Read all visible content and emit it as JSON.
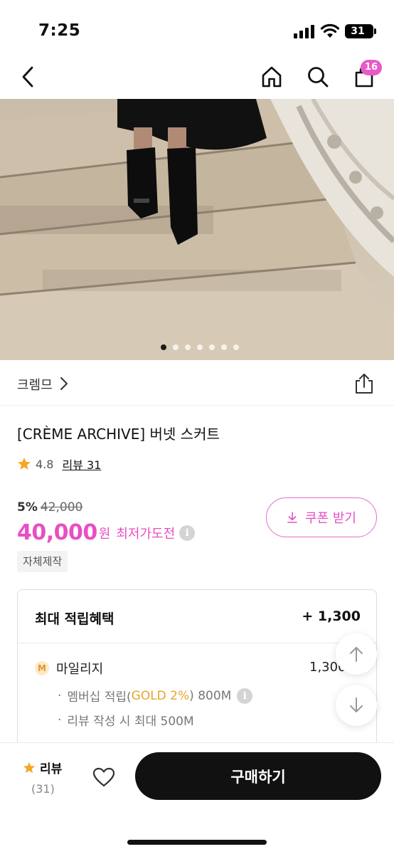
{
  "status_bar": {
    "time": "7:25",
    "battery": "31"
  },
  "nav": {
    "cart_count": "16",
    "back_icon": "back-arrow-icon",
    "home_icon": "home-icon",
    "search_icon": "search-icon",
    "cart_icon": "shopping-bag-icon"
  },
  "hero": {
    "slides": 7,
    "active_slide": 1
  },
  "brand": {
    "name": "크렘므"
  },
  "product": {
    "title": "[CRÈME ARCHIVE] 버넷 스커트",
    "rating": "4.8",
    "review_link": "리뷰 31"
  },
  "price": {
    "discount_rate": "5%",
    "original_price": "42,000",
    "sale_price": "40,000",
    "unit": "원",
    "lowest_label": "최저가도전",
    "coupon_label": "쿠폰 받기",
    "badge": "자체제작"
  },
  "points": {
    "title": "최대 적립혜택",
    "total": "+ 1,300",
    "mileage_icon_letter": "M",
    "mileage_label": "마일리지",
    "mileage_value": "1,300",
    "bullet": "·",
    "membership_prefix": "멤버십 적립(",
    "membership_gold": "GOLD 2%",
    "membership_suffix": ") 800M",
    "review_line": "리뷰 작성 시 최대 500M"
  },
  "bottom_bar": {
    "review_label": "리뷰",
    "review_count": "(31)",
    "buy_label": "구매하기"
  },
  "colors": {
    "accent": "#e94ec2",
    "gold": "#e5a52b",
    "star": "#f5a623",
    "buy_button": "#111111"
  }
}
